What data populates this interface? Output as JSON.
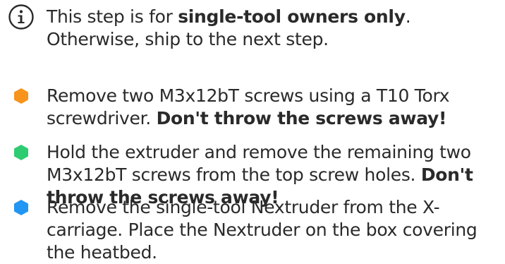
{
  "steps": [
    {
      "icon": "info-icon",
      "text_a": "This step is for ",
      "bold_a": "single-tool owners only",
      "text_b": ". Otherwise, ship to the next step."
    },
    {
      "icon": "hexagon-orange-icon",
      "color": "#f7941d",
      "text_a": "Remove two M3x12bT screws using a T10 Torx screwdriver. ",
      "bold_a": "Don't throw the screws away!"
    },
    {
      "icon": "hexagon-green-icon",
      "color": "#2ecc71",
      "text_a": "Hold the extruder and remove the remaining two M3x12bT screws from the top screw holes. ",
      "bold_a": "Don't throw the screws away!"
    },
    {
      "icon": "hexagon-blue-icon",
      "color": "#2196f3",
      "text_a": "Remove the single-tool Nextruder from the X-carriage. Place the Nextruder on the box covering the heatbed."
    }
  ]
}
